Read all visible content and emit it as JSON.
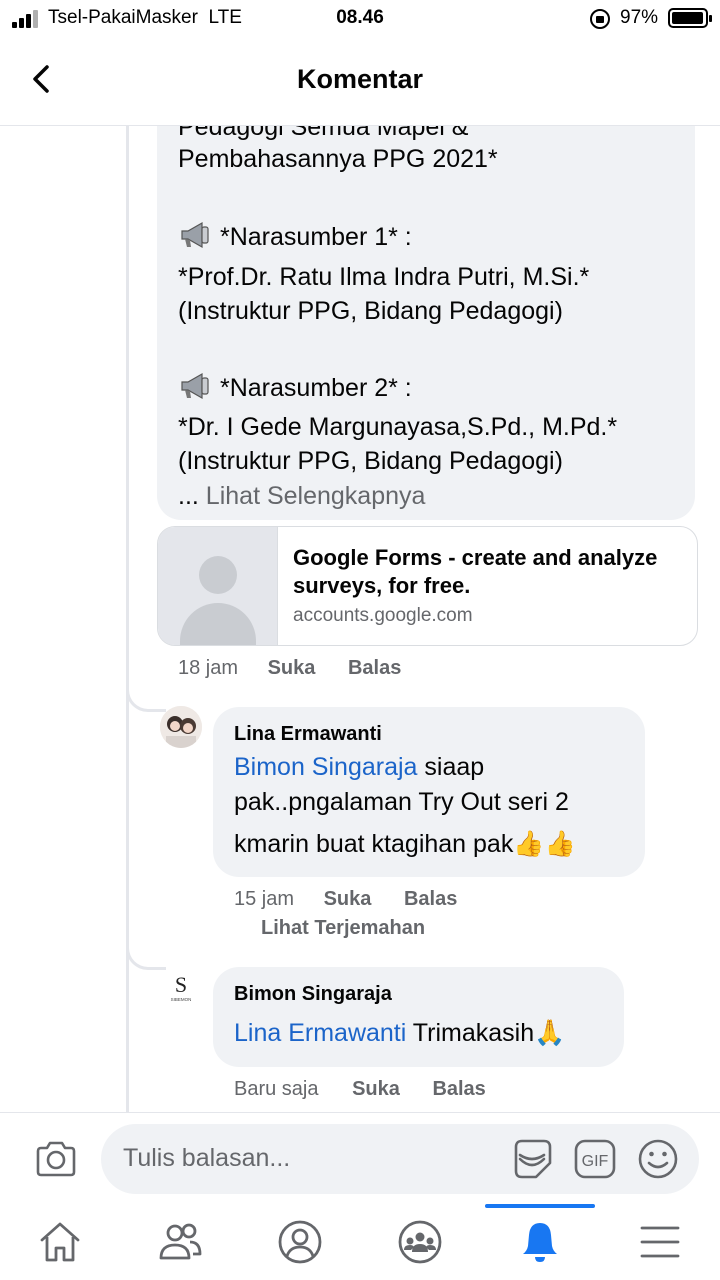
{
  "status_bar": {
    "carrier": "Tsel-PakaiMasker",
    "network": "LTE",
    "time": "08.46",
    "battery": "97%"
  },
  "header": {
    "title": "Komentar"
  },
  "post": {
    "lines": [
      "Pedagogi Semua Mapel &",
      "Pembahasannya PPG 2021*",
      "*Narasumber 1* :",
      "*Prof.Dr. Ratu Ilma Indra Putri, M.Si.*",
      "(Instruktur PPG, Bidang Pedagogi)",
      "*Narasumber 2* :",
      "*Dr. I Gede Margunayasa,S.Pd., M.Pd.*",
      "(Instruktur PPG, Bidang Pedagogi)"
    ],
    "ellipsis": "...",
    "see_more": "Lihat Selengkapnya",
    "link_preview": {
      "title": "Google Forms - create and analyze surveys, for free.",
      "domain": "accounts.google.com"
    },
    "time": "18 jam",
    "like": "Suka",
    "reply": "Balas"
  },
  "replies": [
    {
      "name": "Lina Ermawanti",
      "mention": "Bimon Singaraja",
      "text_line1": " siaap",
      "text_line2": "pak..pngalaman Try Out seri 2",
      "text_line3": "kmarin buat ktagihan pak",
      "emoji": "👍👍",
      "time": "15 jam",
      "like": "Suka",
      "reply": "Balas",
      "translate": "Lihat Terjemahan"
    },
    {
      "name": "Bimon Singaraja",
      "avatar_text": "SIBEMON",
      "mention": "Lina Ermawanti",
      "text": " Trimakasih",
      "emoji": "🙏",
      "time": "Baru saja",
      "like": "Suka",
      "reply": "Balas"
    }
  ],
  "composer": {
    "placeholder": "Tulis balasan..."
  },
  "tabbar": {
    "tabs": [
      "home-icon",
      "friends-icon",
      "profile-icon",
      "groups-icon",
      "notifications-icon",
      "menu-icon"
    ],
    "active": "notifications-icon"
  },
  "colors": {
    "accent": "#1877f2",
    "mention": "#1b64c9",
    "bubble": "#f0f2f5",
    "secondary_text": "#65676b"
  }
}
